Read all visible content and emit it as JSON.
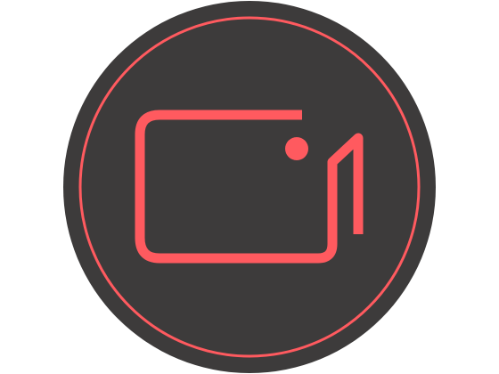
{
  "icon": {
    "name": "video-camera-app-icon",
    "glyph": "video-camera-icon"
  },
  "colors": {
    "page_background": "#ffffff",
    "badge_fill": "#3d3b3b",
    "accent": "#ff5a5f"
  }
}
